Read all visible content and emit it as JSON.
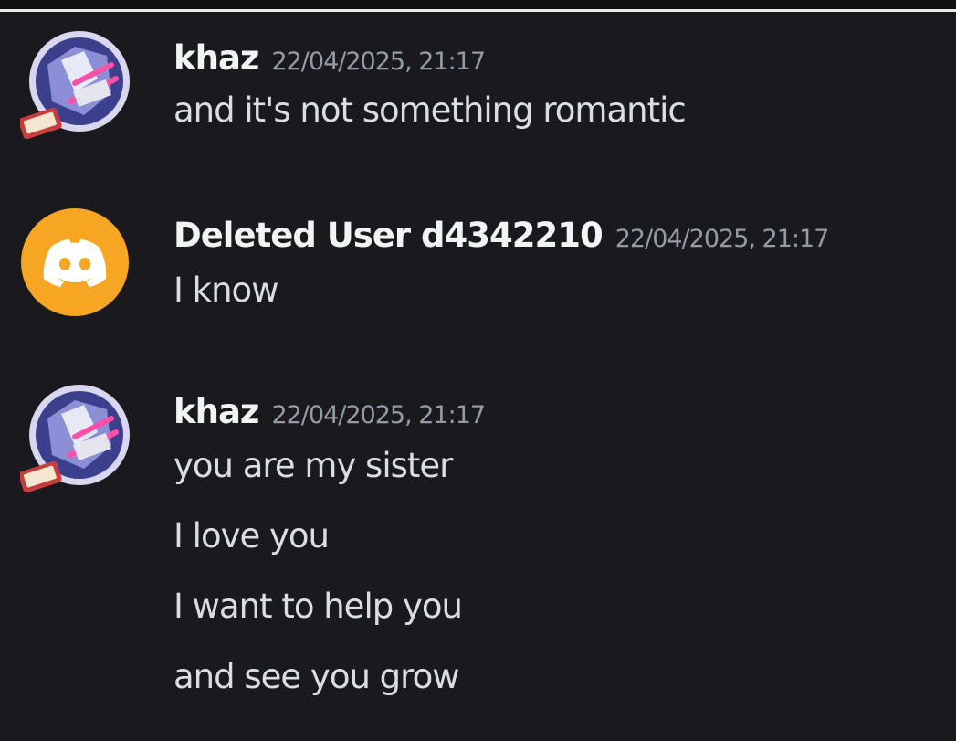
{
  "colors": {
    "background": "#1a1a1e",
    "username": "#f2f3f5",
    "timestamp": "#949ba4",
    "message_text": "#dbdee1",
    "deleted_user_avatar": "#f6a623"
  },
  "messages": [
    {
      "author": "khaz",
      "timestamp": "22/04/2025, 21:17",
      "avatar_icon": "anime-avatar-icon",
      "lines": [
        "and it's not something romantic"
      ]
    },
    {
      "author": "Deleted User d4342210",
      "timestamp": "22/04/2025, 21:17",
      "avatar_icon": "discord-logo-icon",
      "lines": [
        "I know"
      ]
    },
    {
      "author": "khaz",
      "timestamp": "22/04/2025, 21:17",
      "avatar_icon": "anime-avatar-icon",
      "lines": [
        "you are my sister",
        "I love you",
        "I want to help you",
        "and see you grow"
      ]
    }
  ]
}
